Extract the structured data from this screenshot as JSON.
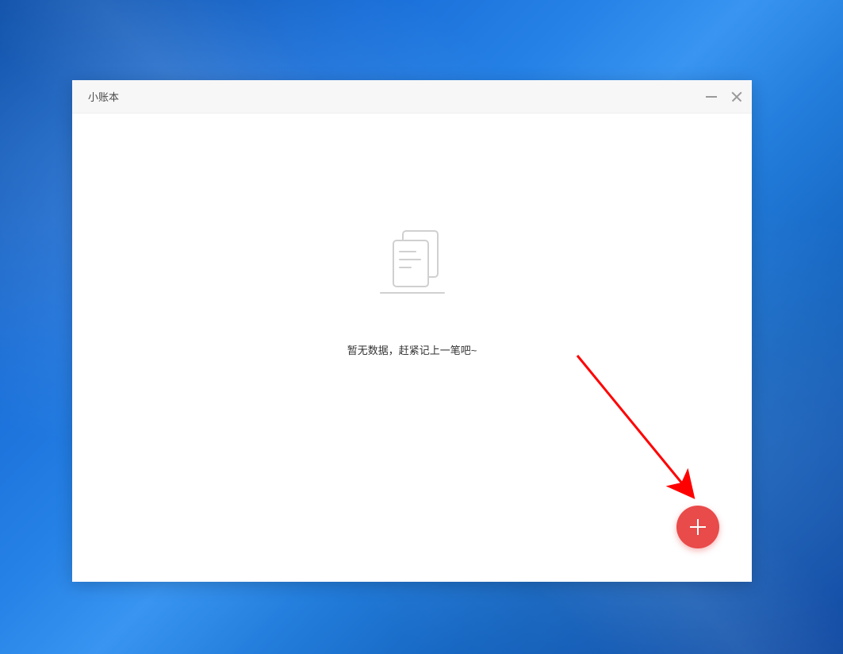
{
  "window": {
    "title": "小账本"
  },
  "content": {
    "empty_message": "暂无数据，赶紧记上一笔吧~"
  },
  "fab": {
    "icon_name": "plus-icon"
  }
}
